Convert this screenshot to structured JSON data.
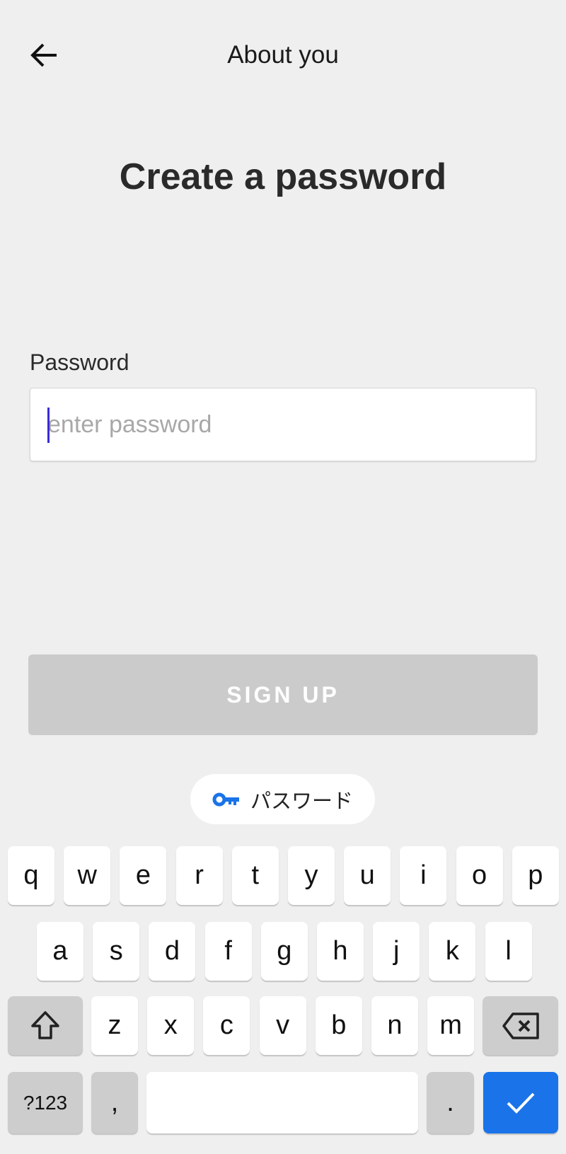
{
  "header": {
    "title": "About you",
    "back_icon": "arrow-left-icon"
  },
  "main": {
    "heading": "Create a password",
    "password_label": "Password",
    "password_placeholder": "enter password",
    "password_value": "",
    "signup_label": "SIGN UP",
    "signup_color": "#cbcbcb"
  },
  "keyboard": {
    "suggestion_chip": {
      "icon": "key-icon",
      "label": "パスワード",
      "icon_color": "#1a73e8"
    },
    "row1": [
      "q",
      "w",
      "e",
      "r",
      "t",
      "y",
      "u",
      "i",
      "o",
      "p"
    ],
    "row2": [
      "a",
      "s",
      "d",
      "f",
      "g",
      "h",
      "j",
      "k",
      "l"
    ],
    "row3": [
      "z",
      "x",
      "c",
      "v",
      "b",
      "n",
      "m"
    ],
    "symbols_label": "?123",
    "comma": ",",
    "period": ".",
    "enter_color": "#1a73e8"
  }
}
